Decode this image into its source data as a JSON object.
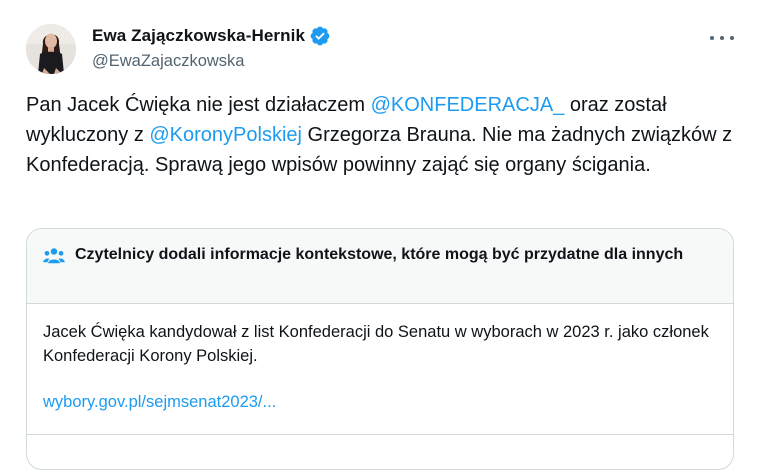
{
  "author": {
    "display_name": "Ewa Zajączkowska-Hernik",
    "handle": "@EwaZajaczkowska",
    "verified_badge_color": "#1d9bf0",
    "verified_icon": "verified-badge-icon",
    "more_icon": "more-options-icon"
  },
  "tweet": {
    "segments": [
      {
        "text": "Pan Jacek Ćwięka nie jest działaczem ",
        "type": "text"
      },
      {
        "text": "@KONFEDERACJA_",
        "type": "mention"
      },
      {
        "text": "  oraz został wykluczony z ",
        "type": "text"
      },
      {
        "text": "@KoronyPolskiej",
        "type": "mention"
      },
      {
        "text": " Grzegorza Brauna. Nie ma żadnych związków z Konfederacją. Sprawą jego wpisów powinny zająć się organy ścigania.",
        "type": "text"
      }
    ]
  },
  "community_note": {
    "icon": "people-icon",
    "title": "Czytelnicy dodali informacje kontekstowe, które mogą być przydatne dla innych",
    "text": "Jacek Ćwięka kandydował z list Konfederacji do Senatu w wyborach w 2023 r. jako członek Konfederacji Korony Polskiej.",
    "link": "wybory.gov.pl/sejmsenat2023/..."
  },
  "colors": {
    "accent": "#1d9bf0",
    "text": "#0f1419",
    "muted": "#536471",
    "border": "#cfd9de",
    "note_header_bg": "#f7f9f9"
  }
}
